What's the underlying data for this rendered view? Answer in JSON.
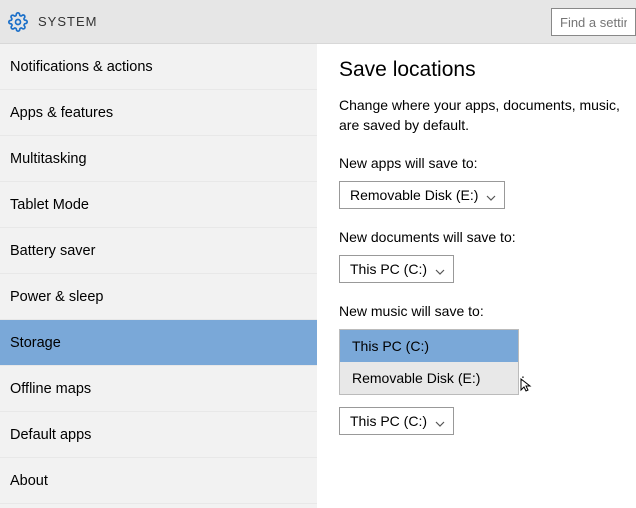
{
  "header": {
    "title": "SYSTEM",
    "search_placeholder": "Find a settin"
  },
  "sidebar": {
    "items": [
      {
        "label": "Notifications & actions",
        "selected": false
      },
      {
        "label": "Apps & features",
        "selected": false
      },
      {
        "label": "Multitasking",
        "selected": false
      },
      {
        "label": "Tablet Mode",
        "selected": false
      },
      {
        "label": "Battery saver",
        "selected": false
      },
      {
        "label": "Power & sleep",
        "selected": false
      },
      {
        "label": "Storage",
        "selected": true
      },
      {
        "label": "Offline maps",
        "selected": false
      },
      {
        "label": "Default apps",
        "selected": false
      },
      {
        "label": "About",
        "selected": false
      }
    ]
  },
  "content": {
    "title": "Save locations",
    "description": "Change where your apps, documents, music, are saved by default.",
    "settings": [
      {
        "label": "New apps will save to:",
        "value": "Removable Disk (E:)"
      },
      {
        "label": "New documents will save to:",
        "value": "This PC (C:)"
      },
      {
        "label": "New music will save to:",
        "value": "This PC (C:)"
      }
    ],
    "dropdown_options": [
      {
        "label": "This PC (C:)",
        "highlighted": true
      },
      {
        "label": "Removable Disk (E:)",
        "highlighted": false
      }
    ],
    "trailing_text": ":",
    "extra_combo_value": "This PC (C:)"
  }
}
